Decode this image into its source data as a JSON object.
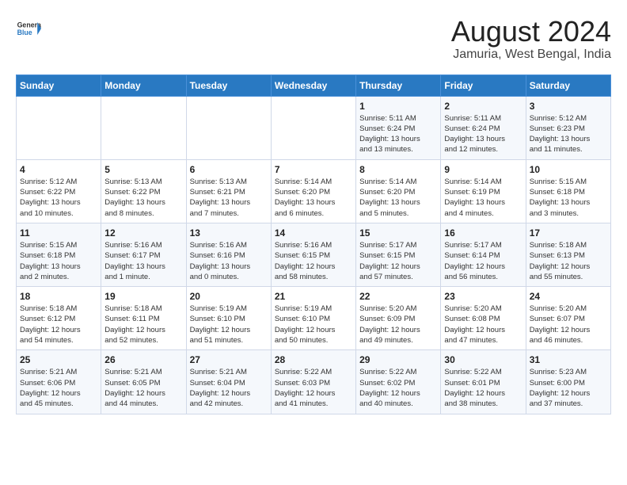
{
  "header": {
    "logo_line1": "General",
    "logo_line2": "Blue",
    "month_year": "August 2024",
    "location": "Jamuria, West Bengal, India"
  },
  "weekdays": [
    "Sunday",
    "Monday",
    "Tuesday",
    "Wednesday",
    "Thursday",
    "Friday",
    "Saturday"
  ],
  "weeks": [
    [
      {
        "day": "",
        "text": ""
      },
      {
        "day": "",
        "text": ""
      },
      {
        "day": "",
        "text": ""
      },
      {
        "day": "",
        "text": ""
      },
      {
        "day": "1",
        "text": "Sunrise: 5:11 AM\nSunset: 6:24 PM\nDaylight: 13 hours\nand 13 minutes."
      },
      {
        "day": "2",
        "text": "Sunrise: 5:11 AM\nSunset: 6:24 PM\nDaylight: 13 hours\nand 12 minutes."
      },
      {
        "day": "3",
        "text": "Sunrise: 5:12 AM\nSunset: 6:23 PM\nDaylight: 13 hours\nand 11 minutes."
      }
    ],
    [
      {
        "day": "4",
        "text": "Sunrise: 5:12 AM\nSunset: 6:22 PM\nDaylight: 13 hours\nand 10 minutes."
      },
      {
        "day": "5",
        "text": "Sunrise: 5:13 AM\nSunset: 6:22 PM\nDaylight: 13 hours\nand 8 minutes."
      },
      {
        "day": "6",
        "text": "Sunrise: 5:13 AM\nSunset: 6:21 PM\nDaylight: 13 hours\nand 7 minutes."
      },
      {
        "day": "7",
        "text": "Sunrise: 5:14 AM\nSunset: 6:20 PM\nDaylight: 13 hours\nand 6 minutes."
      },
      {
        "day": "8",
        "text": "Sunrise: 5:14 AM\nSunset: 6:20 PM\nDaylight: 13 hours\nand 5 minutes."
      },
      {
        "day": "9",
        "text": "Sunrise: 5:14 AM\nSunset: 6:19 PM\nDaylight: 13 hours\nand 4 minutes."
      },
      {
        "day": "10",
        "text": "Sunrise: 5:15 AM\nSunset: 6:18 PM\nDaylight: 13 hours\nand 3 minutes."
      }
    ],
    [
      {
        "day": "11",
        "text": "Sunrise: 5:15 AM\nSunset: 6:18 PM\nDaylight: 13 hours\nand 2 minutes."
      },
      {
        "day": "12",
        "text": "Sunrise: 5:16 AM\nSunset: 6:17 PM\nDaylight: 13 hours\nand 1 minute."
      },
      {
        "day": "13",
        "text": "Sunrise: 5:16 AM\nSunset: 6:16 PM\nDaylight: 13 hours\nand 0 minutes."
      },
      {
        "day": "14",
        "text": "Sunrise: 5:16 AM\nSunset: 6:15 PM\nDaylight: 12 hours\nand 58 minutes."
      },
      {
        "day": "15",
        "text": "Sunrise: 5:17 AM\nSunset: 6:15 PM\nDaylight: 12 hours\nand 57 minutes."
      },
      {
        "day": "16",
        "text": "Sunrise: 5:17 AM\nSunset: 6:14 PM\nDaylight: 12 hours\nand 56 minutes."
      },
      {
        "day": "17",
        "text": "Sunrise: 5:18 AM\nSunset: 6:13 PM\nDaylight: 12 hours\nand 55 minutes."
      }
    ],
    [
      {
        "day": "18",
        "text": "Sunrise: 5:18 AM\nSunset: 6:12 PM\nDaylight: 12 hours\nand 54 minutes."
      },
      {
        "day": "19",
        "text": "Sunrise: 5:18 AM\nSunset: 6:11 PM\nDaylight: 12 hours\nand 52 minutes."
      },
      {
        "day": "20",
        "text": "Sunrise: 5:19 AM\nSunset: 6:10 PM\nDaylight: 12 hours\nand 51 minutes."
      },
      {
        "day": "21",
        "text": "Sunrise: 5:19 AM\nSunset: 6:10 PM\nDaylight: 12 hours\nand 50 minutes."
      },
      {
        "day": "22",
        "text": "Sunrise: 5:20 AM\nSunset: 6:09 PM\nDaylight: 12 hours\nand 49 minutes."
      },
      {
        "day": "23",
        "text": "Sunrise: 5:20 AM\nSunset: 6:08 PM\nDaylight: 12 hours\nand 47 minutes."
      },
      {
        "day": "24",
        "text": "Sunrise: 5:20 AM\nSunset: 6:07 PM\nDaylight: 12 hours\nand 46 minutes."
      }
    ],
    [
      {
        "day": "25",
        "text": "Sunrise: 5:21 AM\nSunset: 6:06 PM\nDaylight: 12 hours\nand 45 minutes."
      },
      {
        "day": "26",
        "text": "Sunrise: 5:21 AM\nSunset: 6:05 PM\nDaylight: 12 hours\nand 44 minutes."
      },
      {
        "day": "27",
        "text": "Sunrise: 5:21 AM\nSunset: 6:04 PM\nDaylight: 12 hours\nand 42 minutes."
      },
      {
        "day": "28",
        "text": "Sunrise: 5:22 AM\nSunset: 6:03 PM\nDaylight: 12 hours\nand 41 minutes."
      },
      {
        "day": "29",
        "text": "Sunrise: 5:22 AM\nSunset: 6:02 PM\nDaylight: 12 hours\nand 40 minutes."
      },
      {
        "day": "30",
        "text": "Sunrise: 5:22 AM\nSunset: 6:01 PM\nDaylight: 12 hours\nand 38 minutes."
      },
      {
        "day": "31",
        "text": "Sunrise: 5:23 AM\nSunset: 6:00 PM\nDaylight: 12 hours\nand 37 minutes."
      }
    ]
  ]
}
